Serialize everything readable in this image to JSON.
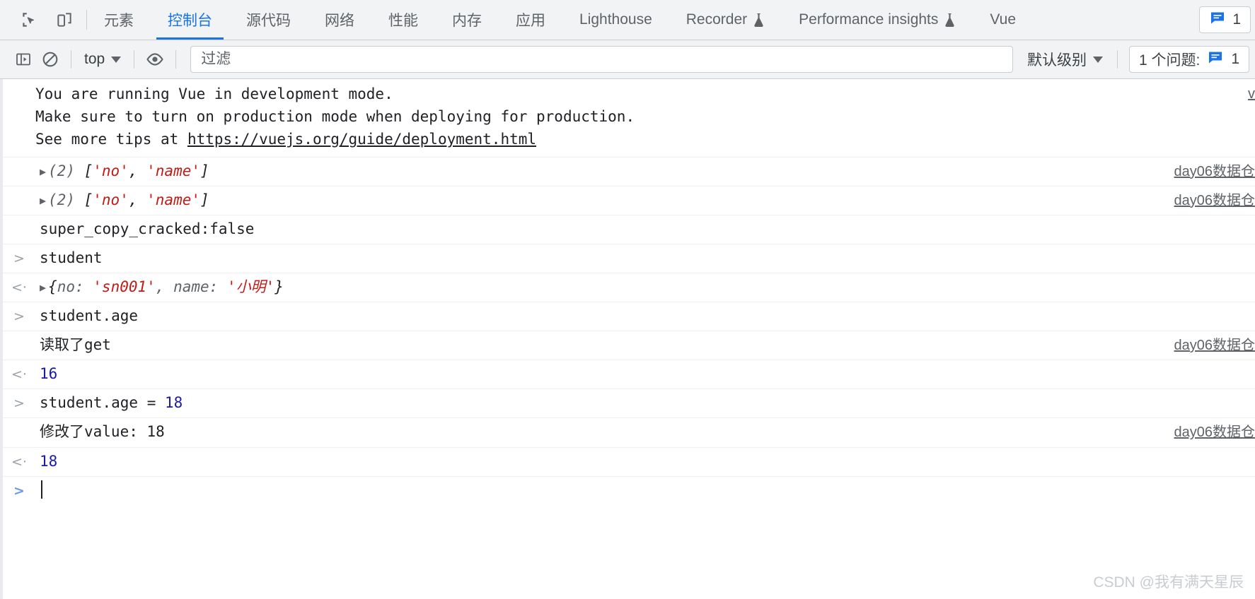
{
  "window": {
    "watermark": "CSDN @我有满天星辰"
  },
  "tabbar": {
    "icons": [
      {
        "name": "inspect-element-icon",
        "label": "检查元素"
      },
      {
        "name": "device-toolbar-icon",
        "label": "切换设备工具栏"
      }
    ],
    "tabs": [
      {
        "label": "元素",
        "active": false,
        "experimental": false
      },
      {
        "label": "控制台",
        "active": true,
        "experimental": false
      },
      {
        "label": "源代码",
        "active": false,
        "experimental": false
      },
      {
        "label": "网络",
        "active": false,
        "experimental": false
      },
      {
        "label": "性能",
        "active": false,
        "experimental": false
      },
      {
        "label": "内存",
        "active": false,
        "experimental": false
      },
      {
        "label": "应用",
        "active": false,
        "experimental": false
      },
      {
        "label": "Lighthouse",
        "active": false,
        "experimental": false
      },
      {
        "label": "Recorder",
        "active": false,
        "experimental": true
      },
      {
        "label": "Performance insights",
        "active": false,
        "experimental": true
      },
      {
        "label": "Vue",
        "active": false,
        "experimental": false
      }
    ],
    "issues_badge": {
      "icon": "message-issue-icon",
      "count": "1"
    }
  },
  "console_toolbar": {
    "sidebar_toggle_icon": "console-sidebar-icon",
    "clear_icon": "clear-console-icon",
    "context": "top",
    "eye_icon": "live-expression-eye-icon",
    "filter": {
      "placeholder": "过滤",
      "value": ""
    },
    "level": "默认级别",
    "issues": {
      "label": "1 个问题:",
      "icon": "message-issue-icon",
      "count": "1"
    }
  },
  "console": {
    "vue_warning": {
      "line1": "You are running Vue in development mode.",
      "line2": "Make sure to turn on production mode when deploying for production.",
      "line3_prefix": "See more tips at ",
      "link": "https://vuejs.org/guide/deployment.html",
      "source": "v"
    },
    "messages": [
      {
        "kind": "log",
        "gutter": "",
        "disclosure": "▶",
        "count": "(2)",
        "open_bracket": " [",
        "s1": "'no'",
        "comma": ", ",
        "s2": "'name'",
        "close_bracket": "]",
        "source": "day06数据仓"
      },
      {
        "kind": "log",
        "gutter": "",
        "disclosure": "▶",
        "count": "(2)",
        "open_bracket": " [",
        "s1": "'no'",
        "comma": ", ",
        "s2": "'name'",
        "close_bracket": "]",
        "source": "day06数据仓"
      },
      {
        "kind": "log-plain",
        "text": "super_copy_cracked:false",
        "source": ""
      },
      {
        "kind": "input",
        "gutter": ">",
        "text": "student",
        "source": ""
      },
      {
        "kind": "result-object",
        "gutter": "<·",
        "disclosure": "▶",
        "open": "{",
        "k1": "no",
        "colon1": ": ",
        "v1": "'sn001'",
        "comma": ", ",
        "k2": "name",
        "colon2": ": ",
        "v2": "'小明'",
        "close": "}",
        "source": ""
      },
      {
        "kind": "input",
        "gutter": ">",
        "text": "student.age",
        "source": ""
      },
      {
        "kind": "log-plain",
        "text": "读取了get",
        "source": "day06数据仓"
      },
      {
        "kind": "result-num",
        "gutter": "<·",
        "text": "16",
        "source": ""
      },
      {
        "kind": "input-assign",
        "gutter": ">",
        "prefix": "student.age = ",
        "number": "18",
        "source": ""
      },
      {
        "kind": "log-plain",
        "text": "修改了value: 18",
        "source": "day06数据仓"
      },
      {
        "kind": "result-num",
        "gutter": "<·",
        "text": "18",
        "source": ""
      },
      {
        "kind": "prompt",
        "gutter": ">",
        "text": ""
      }
    ]
  },
  "colors": {
    "accent": "#1a73e8",
    "string": "#c41a16",
    "number": "#1a1aa6",
    "toolbar_bg": "#f1f3f4",
    "border": "#cacdd1",
    "text": "#202124",
    "muted": "#5f6368"
  }
}
